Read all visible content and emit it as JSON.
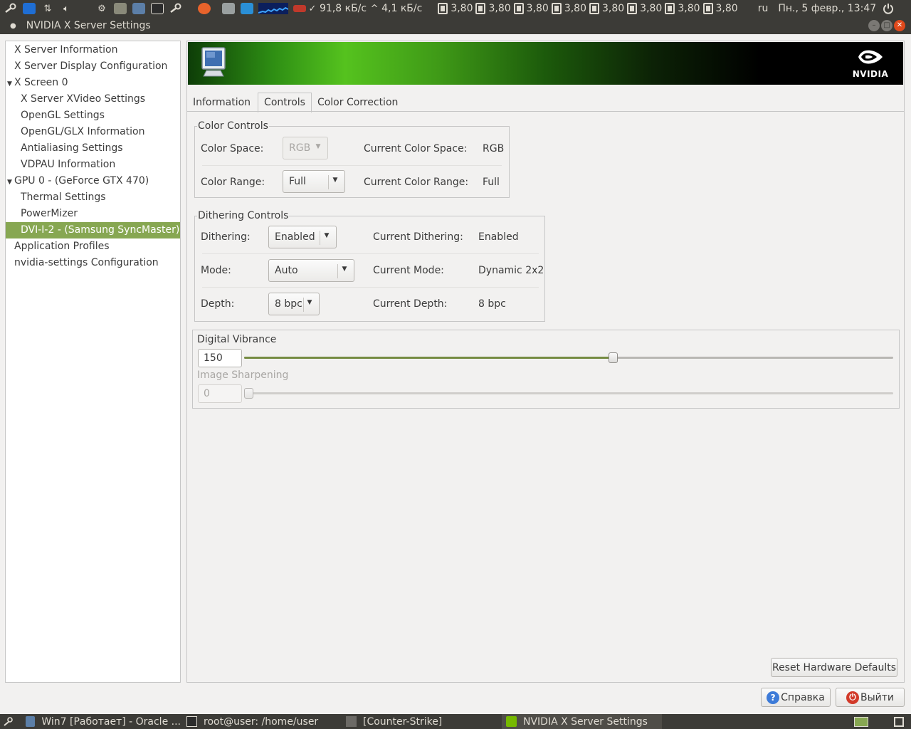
{
  "top_panel": {
    "net_down": "91,8 кБ/с",
    "net_up": "4,1 кБ/с",
    "cpu_freqs": [
      "3,80",
      "3,80",
      "3,80",
      "3,80",
      "3,80",
      "3,80",
      "3,80",
      "3,80"
    ],
    "keyboard_layout": "ru",
    "datetime": "Пн., 5 февр., 13:47"
  },
  "window": {
    "title": "NVIDIA X Server Settings"
  },
  "sidebar": {
    "items": [
      {
        "label": "X Server Information"
      },
      {
        "label": "X Server Display Configuration"
      },
      {
        "label": "X Screen 0"
      },
      {
        "label": "X Server XVideo Settings"
      },
      {
        "label": "OpenGL Settings"
      },
      {
        "label": "OpenGL/GLX Information"
      },
      {
        "label": "Antialiasing Settings"
      },
      {
        "label": "VDPAU Information"
      },
      {
        "label": "GPU 0 - (GeForce GTX 470)"
      },
      {
        "label": "Thermal Settings"
      },
      {
        "label": "PowerMizer"
      },
      {
        "label": "DVI-I-2 - (Samsung SyncMaster)"
      },
      {
        "label": "Application Profiles"
      },
      {
        "label": "nvidia-settings Configuration"
      }
    ]
  },
  "banner": {
    "brand": "NVIDIA"
  },
  "tabs": [
    {
      "label": "Information"
    },
    {
      "label": "Controls"
    },
    {
      "label": "Color Correction"
    }
  ],
  "color_controls": {
    "title": "Color Controls",
    "color_space_label": "Color Space:",
    "color_space_value": "RGB",
    "current_color_space_label": "Current Color Space:",
    "current_color_space_value": "RGB",
    "color_range_label": "Color Range:",
    "color_range_value": "Full",
    "current_color_range_label": "Current Color Range:",
    "current_color_range_value": "Full"
  },
  "dithering_controls": {
    "title": "Dithering Controls",
    "dithering_label": "Dithering:",
    "dithering_value": "Enabled",
    "current_dithering_label": "Current Dithering:",
    "current_dithering_value": "Enabled",
    "mode_label": "Mode:",
    "mode_value": "Auto",
    "current_mode_label": "Current Mode:",
    "current_mode_value": "Dynamic 2x2",
    "depth_label": "Depth:",
    "depth_value": "8 bpc",
    "current_depth_label": "Current Depth:",
    "current_depth_value": "8 bpc"
  },
  "digital_vibrance": {
    "label": "Digital Vibrance",
    "value": "150",
    "fraction": 0.57
  },
  "image_sharpening": {
    "label": "Image Sharpening",
    "value": "0",
    "fraction": 0.0
  },
  "buttons": {
    "reset": "Reset Hardware Defaults",
    "help": "Справка",
    "quit": "Выйти"
  },
  "taskbar": {
    "tasks": [
      {
        "label": "Win7 [Работает] - Oracle ..."
      },
      {
        "label": "root@user: /home/user"
      },
      {
        "label": "[Counter-Strike]"
      },
      {
        "label": "NVIDIA X Server Settings"
      }
    ]
  },
  "colors": {
    "selection": "#87a752",
    "slider_fill": "#768c42",
    "panel_bg": "#3c3b37",
    "window_bg": "#f2f1f0",
    "close_button": "#e0491b"
  }
}
